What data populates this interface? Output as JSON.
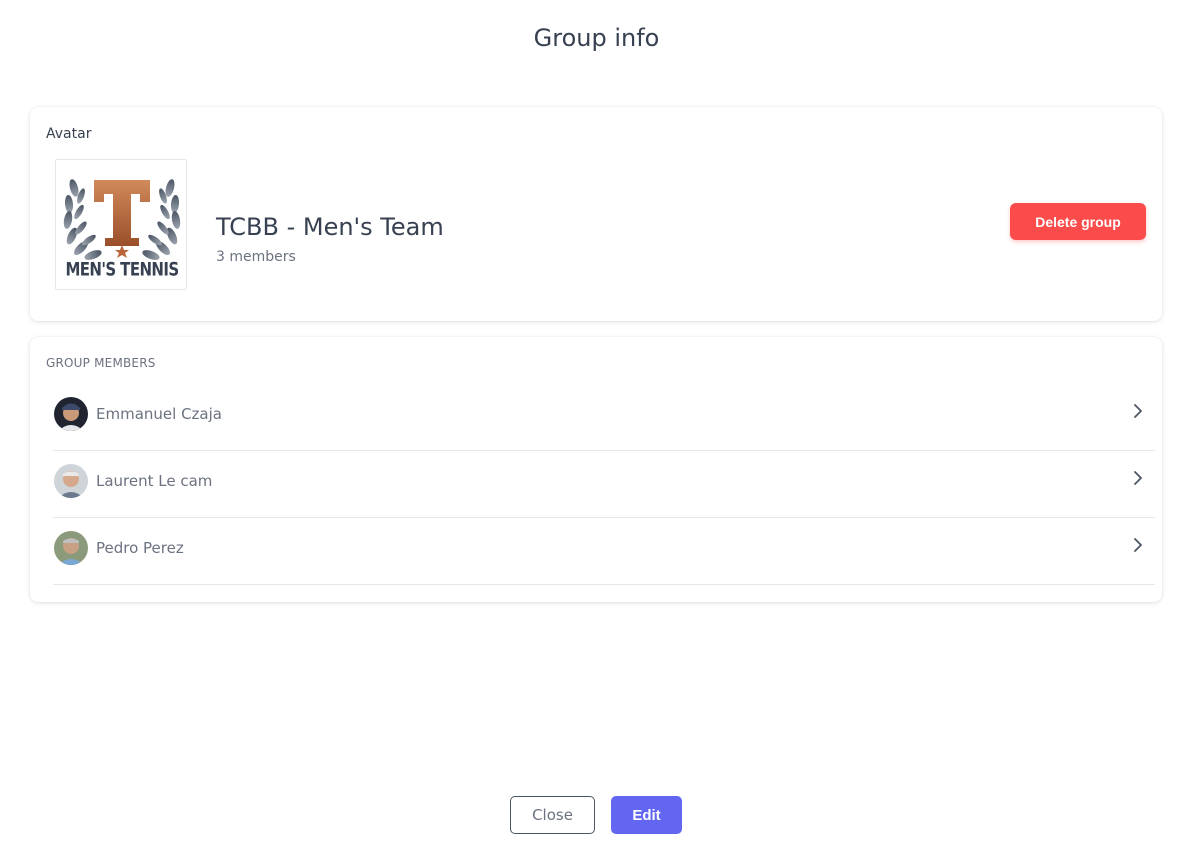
{
  "page": {
    "title": "Group info"
  },
  "avatar_section": {
    "label": "Avatar",
    "logo": {
      "text": "MEN'S TENNIS",
      "letter": "T",
      "icon": "laurel-wreath-icon"
    },
    "group_name": "TCBB - Men's Team",
    "member_count": "3 members",
    "delete_label": "Delete group"
  },
  "members_section": {
    "label": "GROUP MEMBERS",
    "members": [
      {
        "name": "Emmanuel Czaja",
        "icon": "chevron-right-icon"
      },
      {
        "name": "Laurent Le cam",
        "icon": "chevron-right-icon"
      },
      {
        "name": "Pedro Perez",
        "icon": "chevron-right-icon"
      }
    ]
  },
  "footer": {
    "close_label": "Close",
    "edit_label": "Edit"
  },
  "colors": {
    "danger": "#fb4b4b",
    "primary": "#6366f1",
    "logo_letter": "#b8663a",
    "logo_text": "#374151"
  }
}
